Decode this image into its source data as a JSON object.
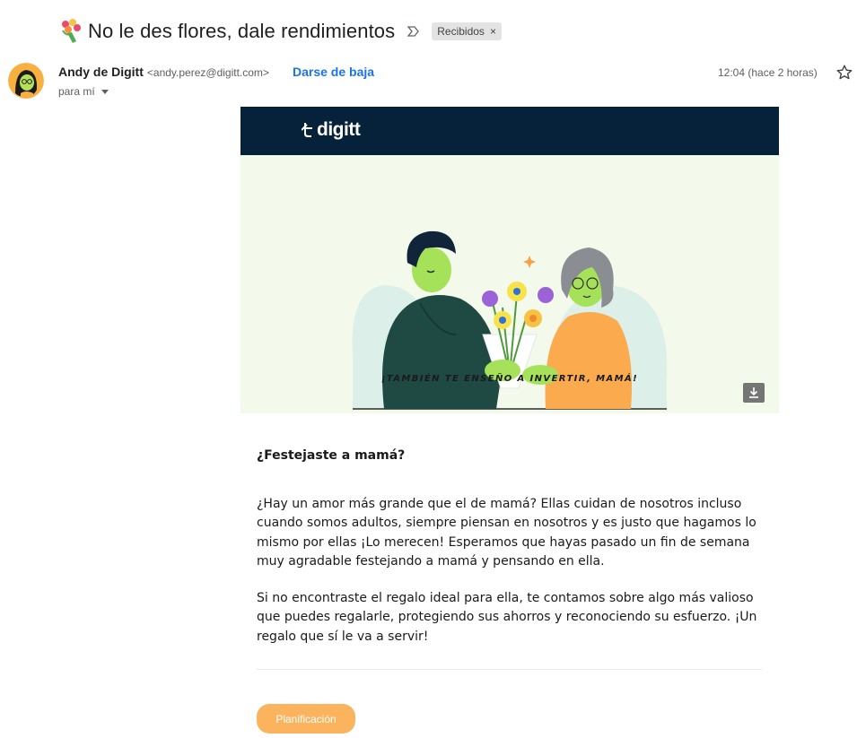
{
  "email": {
    "subject": "No le des flores, dale rendimientos",
    "label": "Recibidos",
    "label_remove": "×",
    "sender_name": "Andy de Digitt",
    "sender_email": "<andy.perez@digitt.com>",
    "unsubscribe": "Darse de baja",
    "recipient": "para mí",
    "time": "12:04 (hace 2 horas)"
  },
  "body": {
    "brand": "digitt",
    "caption": "¡TAMBIÉN TE ENSEÑO A INVERTIR, MAMÁ!",
    "heading": "¿Festejaste a mamá?",
    "paragraph1": "¿Hay un amor más grande que el de mamá? Ellas cuidan de nosotros incluso cuando somos adultos, siempre piensan en nosotros y es justo que hagamos lo mismo por ellas ¡Lo merecen! Esperamos que hayas pasado un fin de semana muy agradable festejando a mamá y pensando en ella.",
    "paragraph2": "Si no encontraste el regalo ideal para ella, te contamos sobre algo más valioso que puedes regalarle, protegiendo sus ahorros y reconociendo su esfuerzo. ¡Un regalo que sí le va a servir!",
    "cta": "Planificación"
  },
  "icons": {
    "subject": "bouquet-icon",
    "important": "importance-marker-icon",
    "star": "star-icon",
    "download": "download-icon",
    "caret": "chevron-down-icon"
  },
  "colors": {
    "brand_bar": "#06223a",
    "hero_bg": "#f4faeb",
    "link": "#1a73e8",
    "cta": "#fbb35e"
  }
}
